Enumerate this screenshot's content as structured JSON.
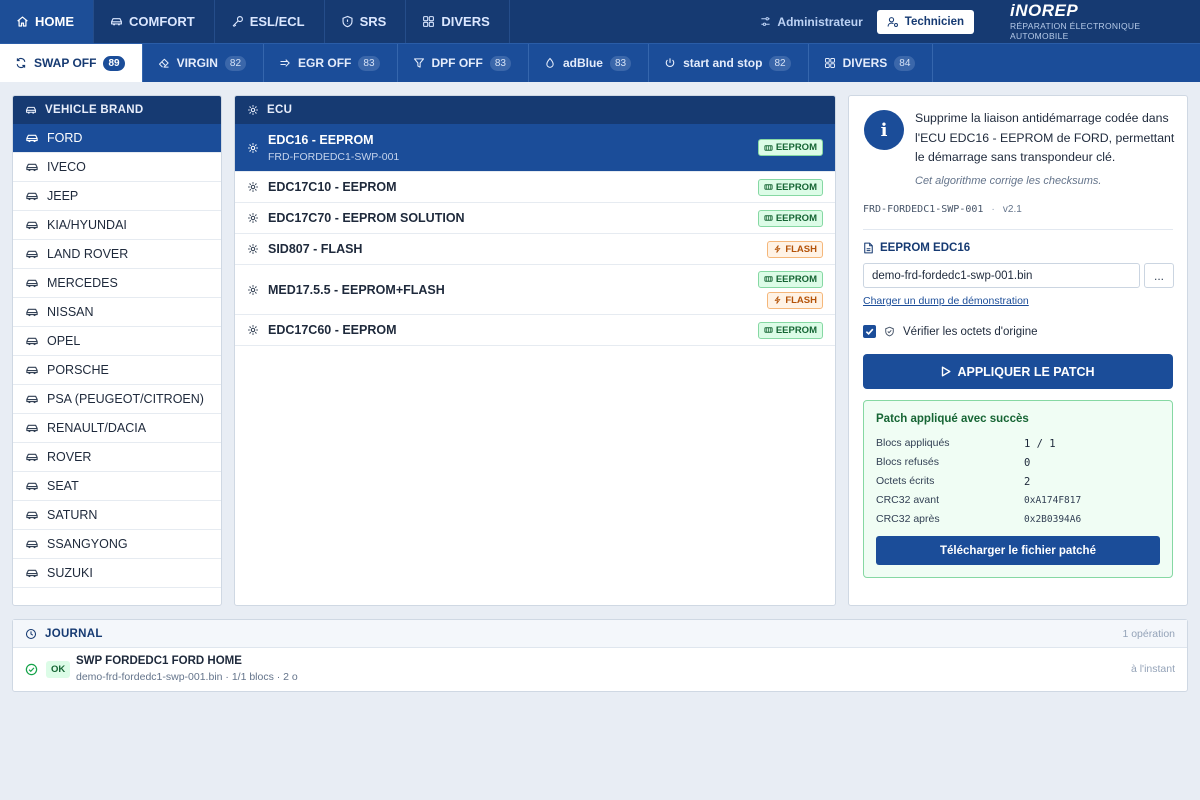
{
  "topnav": {
    "tabs": [
      {
        "label": "HOME",
        "icon": "home-icon",
        "active": true
      },
      {
        "label": "COMFORT",
        "icon": "car-icon"
      },
      {
        "label": "ESL/ECL",
        "icon": "key-icon"
      },
      {
        "label": "SRS",
        "icon": "shield-icon"
      },
      {
        "label": "DIVERS",
        "icon": "grid-icon"
      }
    ],
    "admin_label": "Administrateur",
    "tech_label": "Technicien",
    "logo_name": "iNOREP",
    "logo_tagline": "RÉPARATION ÉLECTRONIQUE AUTOMOBILE"
  },
  "subnav": {
    "tabs": [
      {
        "label": "SWAP OFF",
        "count": "89",
        "icon": "swap-icon",
        "active": true
      },
      {
        "label": "VIRGIN",
        "count": "82",
        "icon": "eraser-icon"
      },
      {
        "label": "EGR OFF",
        "count": "83",
        "icon": "valve-icon"
      },
      {
        "label": "DPF OFF",
        "count": "83",
        "icon": "filter-icon"
      },
      {
        "label": "adBlue",
        "count": "83",
        "icon": "droplet-icon"
      },
      {
        "label": "start and stop",
        "count": "82",
        "icon": "power-icon"
      },
      {
        "label": "DIVERS",
        "count": "84",
        "icon": "grid-icon"
      }
    ]
  },
  "brands": {
    "title": "VEHICLE BRAND",
    "items": [
      "FORD",
      "IVECO",
      "JEEP",
      "KIA/HYUNDAI",
      "LAND ROVER",
      "MERCEDES",
      "NISSAN",
      "OPEL",
      "PORSCHE",
      "PSA (PEUGEOT/CITROEN)",
      "RENAULT/DACIA",
      "ROVER",
      "SEAT",
      "SATURN",
      "SSANGYONG",
      "SUZUKI"
    ],
    "selected": "FORD"
  },
  "ecu": {
    "title": "ECU",
    "items": [
      {
        "name": "EDC16 - EEPROM",
        "ref": "FRD-FORDEDC1-SWP-001",
        "tags": [
          "EEPROM"
        ],
        "active": true
      },
      {
        "name": "EDC17C10 - EEPROM",
        "ref": "",
        "tags": [
          "EEPROM"
        ]
      },
      {
        "name": "EDC17C70 - EEPROM SOLUTION",
        "ref": "",
        "tags": [
          "EEPROM"
        ]
      },
      {
        "name": "SID807 - FLASH",
        "ref": "",
        "tags": [
          "FLASH"
        ]
      },
      {
        "name": "MED17.5.5 - EEPROM+FLASH",
        "ref": "",
        "tags": [
          "EEPROM",
          "FLASH"
        ]
      },
      {
        "name": "EDC17C60 - EEPROM",
        "ref": "",
        "tags": [
          "EEPROM"
        ]
      }
    ]
  },
  "detail": {
    "description": "Supprime la liaison antidémarrage codée dans l'ECU EDC16 - EEPROM de FORD, permettant le démarrage sans transpondeur clé.",
    "note": "Cet algorithme corrige les checksums.",
    "ref": "FRD-FORDEDC1-SWP-001",
    "separator": "·",
    "version": "v2.1",
    "file_title": "EEPROM EDC16",
    "file_value": "demo-frd-fordedc1-swp-001.bin",
    "browse_label": "...",
    "demo_link": "Charger un dump de démonstration",
    "verify_label": "Vérifier les octets d'origine",
    "verify_checked": true,
    "apply_label": "APPLIQUER LE PATCH",
    "result": {
      "title": "Patch appliqué avec succès",
      "rows": [
        {
          "label": "Blocs appliqués",
          "value": "1 / 1"
        },
        {
          "label": "Blocs refusés",
          "value": "0"
        },
        {
          "label": "Octets écrits",
          "value": "2"
        },
        {
          "label": "CRC32 avant",
          "value": "0xA174F817"
        },
        {
          "label": "CRC32 après",
          "value": "0x2B0394A6"
        }
      ],
      "download_label": "Télécharger le fichier patché"
    }
  },
  "journal": {
    "title": "JOURNAL",
    "count": "1 opération",
    "entries": [
      {
        "status": "OK",
        "title": "SWP FORDEDC1 FORD HOME",
        "subtitle": "demo-frd-fordedc1-swp-001.bin · 1/1 blocs · 2 o",
        "time": "à l'instant"
      }
    ]
  },
  "colors": {
    "primary": "#1b4d99",
    "navy": "#163a72",
    "success": "#166534",
    "flash": "#b45309"
  }
}
